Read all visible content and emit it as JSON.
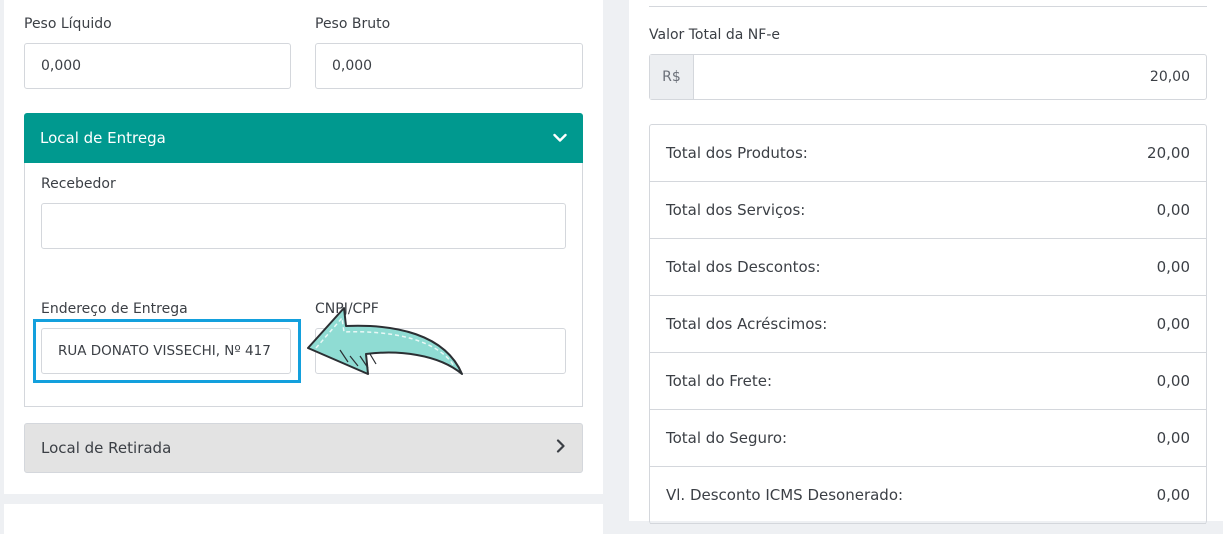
{
  "left": {
    "peso_liquido": {
      "label": "Peso Líquido",
      "value": "0,000"
    },
    "peso_bruto": {
      "label": "Peso Bruto",
      "value": "0,000"
    },
    "local_entrega": {
      "title": "Local de Entrega",
      "recebedor": {
        "label": "Recebedor",
        "value": ""
      },
      "endereco": {
        "label": "Endereço de Entrega",
        "value": "RUA DONATO VISSECHI, Nº 417"
      },
      "cnpj": {
        "label": "CNPJ/CPF",
        "value": ""
      }
    },
    "local_retirada": {
      "title": "Local de Retirada"
    }
  },
  "right": {
    "valor_total": {
      "label": "Valor Total da NF-e",
      "prefix": "R$",
      "value": "20,00"
    },
    "totals": [
      {
        "label": "Total dos Produtos:",
        "value": "20,00"
      },
      {
        "label": "Total dos Serviços:",
        "value": "0,00"
      },
      {
        "label": "Total dos Descontos:",
        "value": "0,00"
      },
      {
        "label": "Total dos Acréscimos:",
        "value": "0,00"
      },
      {
        "label": "Total do Frete:",
        "value": "0,00"
      },
      {
        "label": "Total do Seguro:",
        "value": "0,00"
      },
      {
        "label": "Vl. Desconto ICMS Desonerado:",
        "value": "0,00"
      }
    ]
  },
  "colors": {
    "accent": "#00998f",
    "highlight": "#13a0dd",
    "arrow_fill": "#8fdcd3"
  },
  "icons": {
    "expand": "chevron-down-icon",
    "collapse": "chevron-right-icon",
    "annotation": "curved-arrow-icon"
  }
}
